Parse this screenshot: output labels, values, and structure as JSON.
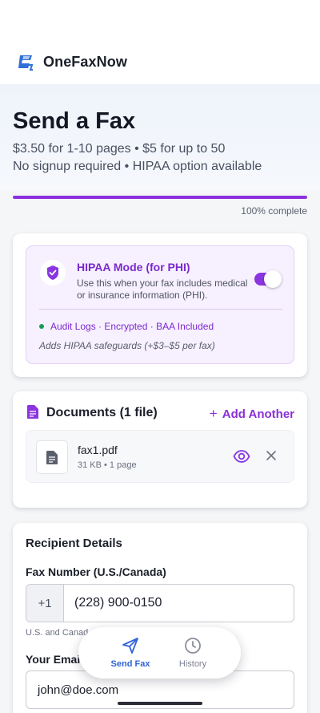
{
  "app": {
    "brand": "OneFaxNow"
  },
  "hero": {
    "title": "Send a Fax",
    "pricing": "$3.50 for 1-10 pages • $5 for up to 50",
    "subtitle": "No signup required • HIPAA option available"
  },
  "progress": {
    "percent": 100,
    "label": "100% complete"
  },
  "hipaa": {
    "title": "HIPAA Mode (for PHI)",
    "description": "Use this when your fax includes medical or insurance information (PHI).",
    "enabled": true,
    "features": "Audit Logs · Encrypted · BAA Included",
    "note": "Adds HIPAA safeguards (+$3–$5 per fax)"
  },
  "documents": {
    "title": "Documents (1 file)",
    "add_label": "Add Another",
    "files": [
      {
        "name": "fax1.pdf",
        "meta": "31 KB • 1 page"
      }
    ]
  },
  "recipient": {
    "title": "Recipient Details",
    "fax_label": "Fax Number (U.S./Canada)",
    "prefix": "+1",
    "fax_value": "(228) 900-0150",
    "fax_help": "U.S. and Canad",
    "email_label": "Your Email",
    "email_value": "john@doe.com"
  },
  "nav": {
    "send_label": "Send Fax",
    "history_label": "History"
  },
  "colors": {
    "accent": "#8b2fe0",
    "nav_active": "#2f64d6",
    "success_dot": "#1a9c57"
  }
}
